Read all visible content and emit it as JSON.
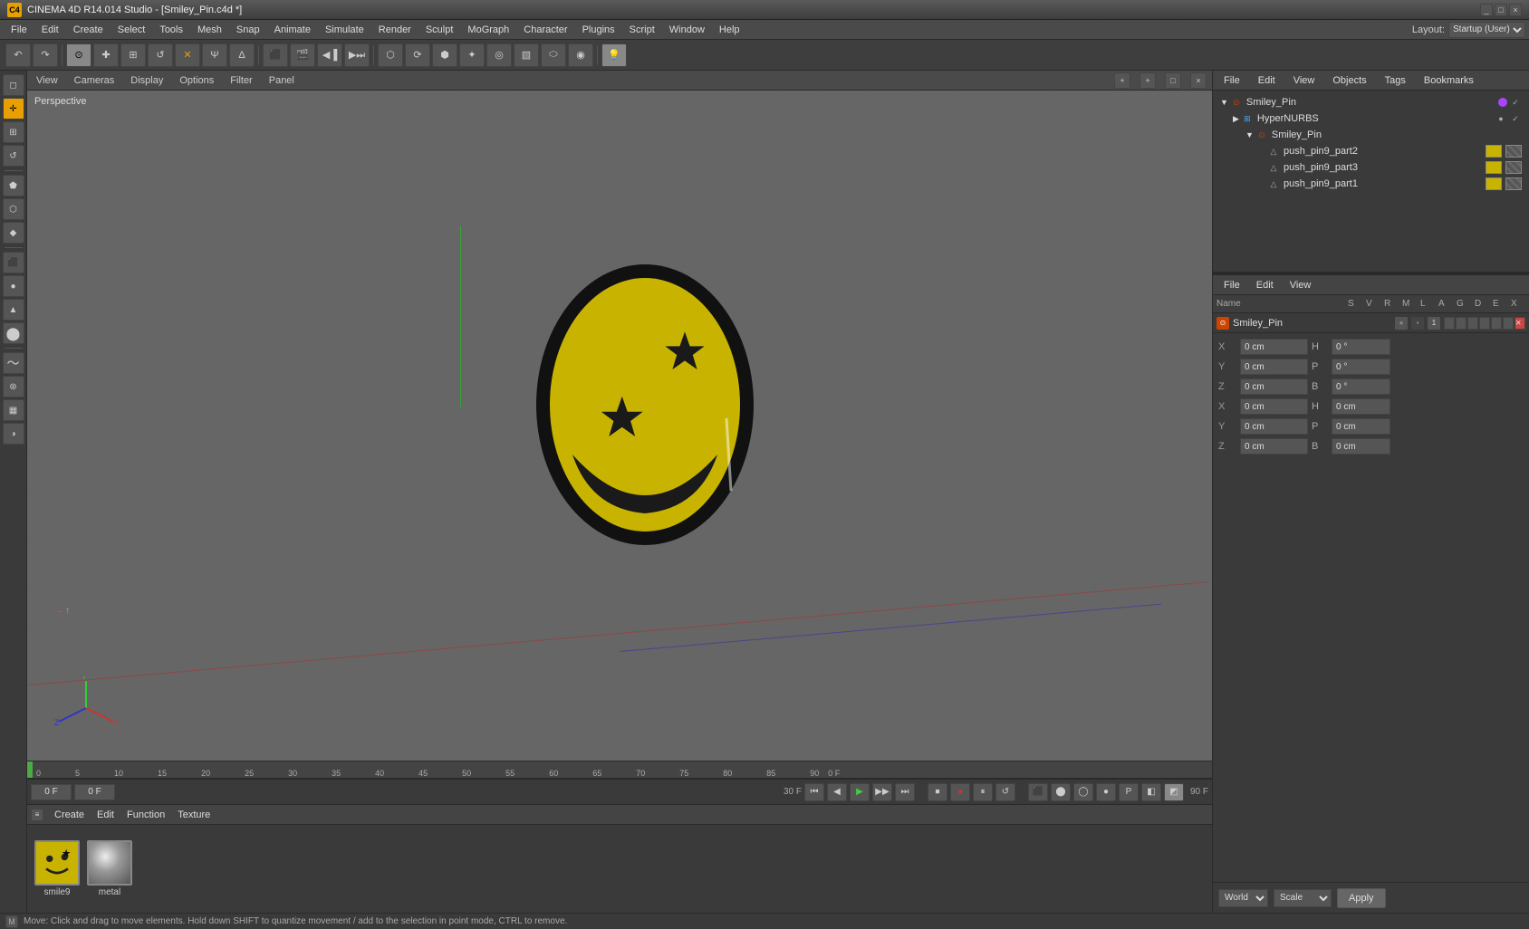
{
  "titleBar": {
    "title": "CINEMA 4D R14.014 Studio - [Smiley_Pin.c4d *]",
    "iconLabel": "C4",
    "controls": [
      "_",
      "□",
      "×"
    ]
  },
  "menuBar": {
    "items": [
      "File",
      "Edit",
      "Create",
      "Select",
      "Tools",
      "Mesh",
      "Snap",
      "Animate",
      "Simulate",
      "Render",
      "Sculpt",
      "MoGraph",
      "Character",
      "Plugins",
      "Script",
      "Window",
      "Help"
    ]
  },
  "topToolbar": {
    "groups": [
      {
        "name": "history",
        "buttons": [
          "↶",
          "↷"
        ]
      },
      {
        "name": "tools",
        "buttons": [
          "⊕",
          "✚",
          "⊙",
          "✦",
          "✕",
          "Ψ",
          "Δ"
        ]
      },
      {
        "name": "view",
        "buttons": [
          "⬛",
          "🎬",
          "◀",
          "▶",
          "⏭"
        ]
      },
      {
        "name": "snap",
        "buttons": [
          "⬡",
          "⟳",
          "⬢",
          "✦",
          "◎",
          "▧",
          "⬭",
          "◉",
          "💡"
        ]
      }
    ]
  },
  "leftToolbar": {
    "buttons": [
      {
        "id": "select",
        "label": "◻",
        "active": false
      },
      {
        "id": "move",
        "label": "✛",
        "active": true
      },
      {
        "id": "scale",
        "label": "⊞",
        "active": false
      },
      {
        "id": "rotate",
        "label": "↺",
        "active": false
      },
      {
        "id": "sep1",
        "label": "",
        "separator": true
      },
      {
        "id": "polygon",
        "label": "⬟",
        "active": false
      },
      {
        "id": "edge",
        "label": "⬡",
        "active": false
      },
      {
        "id": "point",
        "label": "◆",
        "active": false
      },
      {
        "id": "sep2",
        "label": "",
        "separator": true
      },
      {
        "id": "box",
        "label": "⬛",
        "active": false
      },
      {
        "id": "sphere",
        "label": "●",
        "active": false
      },
      {
        "id": "cone",
        "label": "▲",
        "active": false
      },
      {
        "id": "cylinder",
        "label": "⬤",
        "active": false
      },
      {
        "id": "sep3",
        "label": "",
        "separator": true
      },
      {
        "id": "spline",
        "label": "〜",
        "active": false
      },
      {
        "id": "nurbs",
        "label": "⊛",
        "active": false
      },
      {
        "id": "layer",
        "label": "▦",
        "active": false
      },
      {
        "id": "material",
        "label": "◑",
        "active": false
      }
    ]
  },
  "viewport": {
    "label": "Perspective",
    "headerTabs": [
      "View",
      "Cameras",
      "Display",
      "Options",
      "Filter",
      "Panel"
    ],
    "controls": [
      "+",
      "+",
      "□",
      "×"
    ]
  },
  "timeline": {
    "currentFrame": "0 F",
    "frameInput": "0 F",
    "fps": "30 F",
    "endFrame": "90 F",
    "markers": [
      0,
      5,
      10,
      15,
      20,
      25,
      30,
      35,
      40,
      45,
      50,
      55,
      60,
      65,
      70,
      75,
      80,
      85,
      90
    ],
    "playbackButtons": [
      "⏮",
      "◀",
      "▶",
      "▶▶",
      "⏭",
      "⏹",
      "●",
      "⏸",
      "↺"
    ],
    "extraButtons": [
      "⬛",
      "⬤",
      "◯",
      "●",
      "P",
      "◧",
      "◩"
    ]
  },
  "materialsPanel": {
    "menuItems": [
      "Create",
      "Edit",
      "Function",
      "Texture"
    ],
    "materials": [
      {
        "name": "smile9",
        "type": "smiley"
      },
      {
        "name": "metal",
        "type": "metal"
      }
    ]
  },
  "objectManager": {
    "menuItems": [
      "File",
      "Edit",
      "View",
      "Objects",
      "Tags",
      "Bookmarks"
    ],
    "layoutLabel": "Layout:",
    "layoutValue": "Startup (User)",
    "tree": [
      {
        "id": "smiley-pin-root",
        "label": "Smiley_Pin",
        "level": 0,
        "arrow": "▼",
        "iconColor": "#cc4400",
        "hasChildren": true,
        "colorDot": "#aa44ff"
      },
      {
        "id": "hyper-nurbs",
        "label": "HyperNURBS",
        "level": 1,
        "arrow": "▶",
        "iconColor": "#44aaff",
        "hasChildren": true,
        "colorDot": "#44aaff"
      },
      {
        "id": "smiley-pin-child",
        "label": "Smiley_Pin",
        "level": 2,
        "arrow": "▼",
        "iconColor": "#cc4400",
        "hasChildren": true,
        "colorDot": ""
      },
      {
        "id": "push-pin9-part2",
        "label": "push_pin9_part2",
        "level": 3,
        "arrow": "",
        "iconColor": "#aaaaaa",
        "hasChildren": false,
        "colorDot": ""
      },
      {
        "id": "push-pin9-part3",
        "label": "push_pin9_part3",
        "level": 3,
        "arrow": "",
        "iconColor": "#aaaaaa",
        "hasChildren": false,
        "colorDot": ""
      },
      {
        "id": "push-pin9-part1",
        "label": "push_pin9_part1",
        "level": 3,
        "arrow": "",
        "iconColor": "#aaaaaa",
        "hasChildren": false,
        "colorDot": ""
      }
    ]
  },
  "attributesPanel": {
    "menuItems": [
      "File",
      "Edit",
      "View"
    ],
    "columns": [
      "Name",
      "S",
      "V",
      "R",
      "M",
      "L",
      "A",
      "G",
      "D",
      "E",
      "X"
    ],
    "selectedObject": "Smiley_Pin",
    "coords": {
      "X": {
        "pos": "0 cm",
        "size": "H",
        "sizeVal": "0 °"
      },
      "Y": {
        "pos": "0 cm",
        "size": "P",
        "sizeVal": "0 °"
      },
      "Z": {
        "pos": "0 cm",
        "size": "B",
        "sizeVal": "0 °"
      }
    },
    "coordX": "0 cm",
    "coordY": "0 cm",
    "coordZ": "0 cm",
    "sizeH": "0 °",
    "sizeP": "0 °",
    "sizeB": "0 °",
    "coordXSize": "0 cm",
    "coordYSize": "0 cm",
    "coordZSize": "0 cm",
    "coordMode": "World",
    "transformMode": "Scale",
    "applyLabel": "Apply"
  },
  "statusBar": {
    "icon": "M",
    "text": "Move: Click and drag to move elements. Hold down SHIFT to quantize movement / add to the selection in point mode, CTRL to remove."
  },
  "colors": {
    "accent": "#e8a000",
    "background": "#3c3c3c",
    "panelBg": "#3a3a3a",
    "headerBg": "#444444",
    "gridLine": "rgba(100,100,100,0.5)",
    "viewportBg": "#666666",
    "selected": "#1a6ea8",
    "applyBtn": "#666666"
  }
}
